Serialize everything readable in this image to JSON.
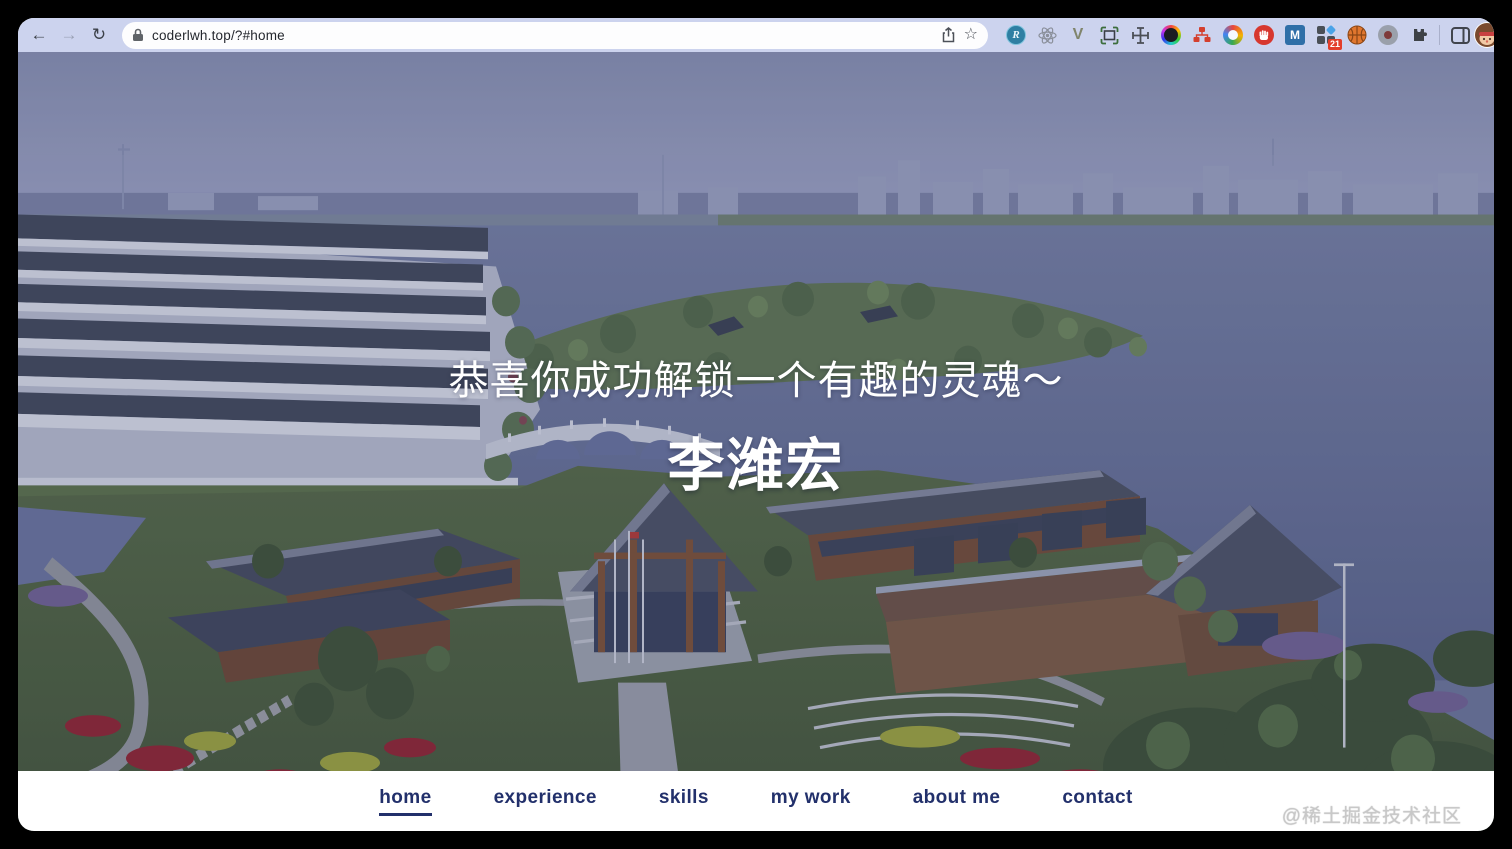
{
  "browser": {
    "url": "coderlwh.top/?#home",
    "nav_icons": {
      "back": "←",
      "forward": "→",
      "reload": "↻"
    },
    "omnibox_icons": {
      "lock": "padlock",
      "share": "share-up-arrow",
      "bookmark": "☆"
    },
    "extensions_badge": "21",
    "extensions": [
      {
        "id": "r-circle",
        "label": "R"
      },
      {
        "id": "react-devtools",
        "label": ""
      },
      {
        "id": "vue-devtools",
        "label": "V"
      },
      {
        "id": "screenshot-frame",
        "label": ""
      },
      {
        "id": "move-tool",
        "label": ""
      },
      {
        "id": "color-lens",
        "label": ""
      },
      {
        "id": "sitemap-red",
        "label": ""
      },
      {
        "id": "colorful-ring",
        "label": ""
      },
      {
        "id": "adblock-hand",
        "label": ""
      },
      {
        "id": "m-square",
        "label": "M"
      },
      {
        "id": "tab-tiles",
        "label": ""
      },
      {
        "id": "basketball",
        "label": ""
      },
      {
        "id": "gray-dot",
        "label": ""
      },
      {
        "id": "extensions-puzzle",
        "label": ""
      }
    ],
    "side_panel_icon": "side-panel-square",
    "profile_icon": "cartoon-avatar"
  },
  "hero": {
    "subtitle": "恭喜你成功解锁一个有趣的灵魂～",
    "title": "李潍宏"
  },
  "nav": {
    "items": [
      {
        "label": "home",
        "active": true
      },
      {
        "label": "experience",
        "active": false
      },
      {
        "label": "skills",
        "active": false
      },
      {
        "label": "my work",
        "active": false
      },
      {
        "label": "about me",
        "active": false
      },
      {
        "label": "contact",
        "active": false
      }
    ]
  },
  "watermark": "@稀土掘金技术社区",
  "colors": {
    "toolbar": "#ccd3ee",
    "navbar_text": "#22306b",
    "photo_overlay": "rgba(44,54,108,0.15)",
    "sky": "#8a92b1",
    "water": "#66719a",
    "lawn": "#4d6040"
  }
}
